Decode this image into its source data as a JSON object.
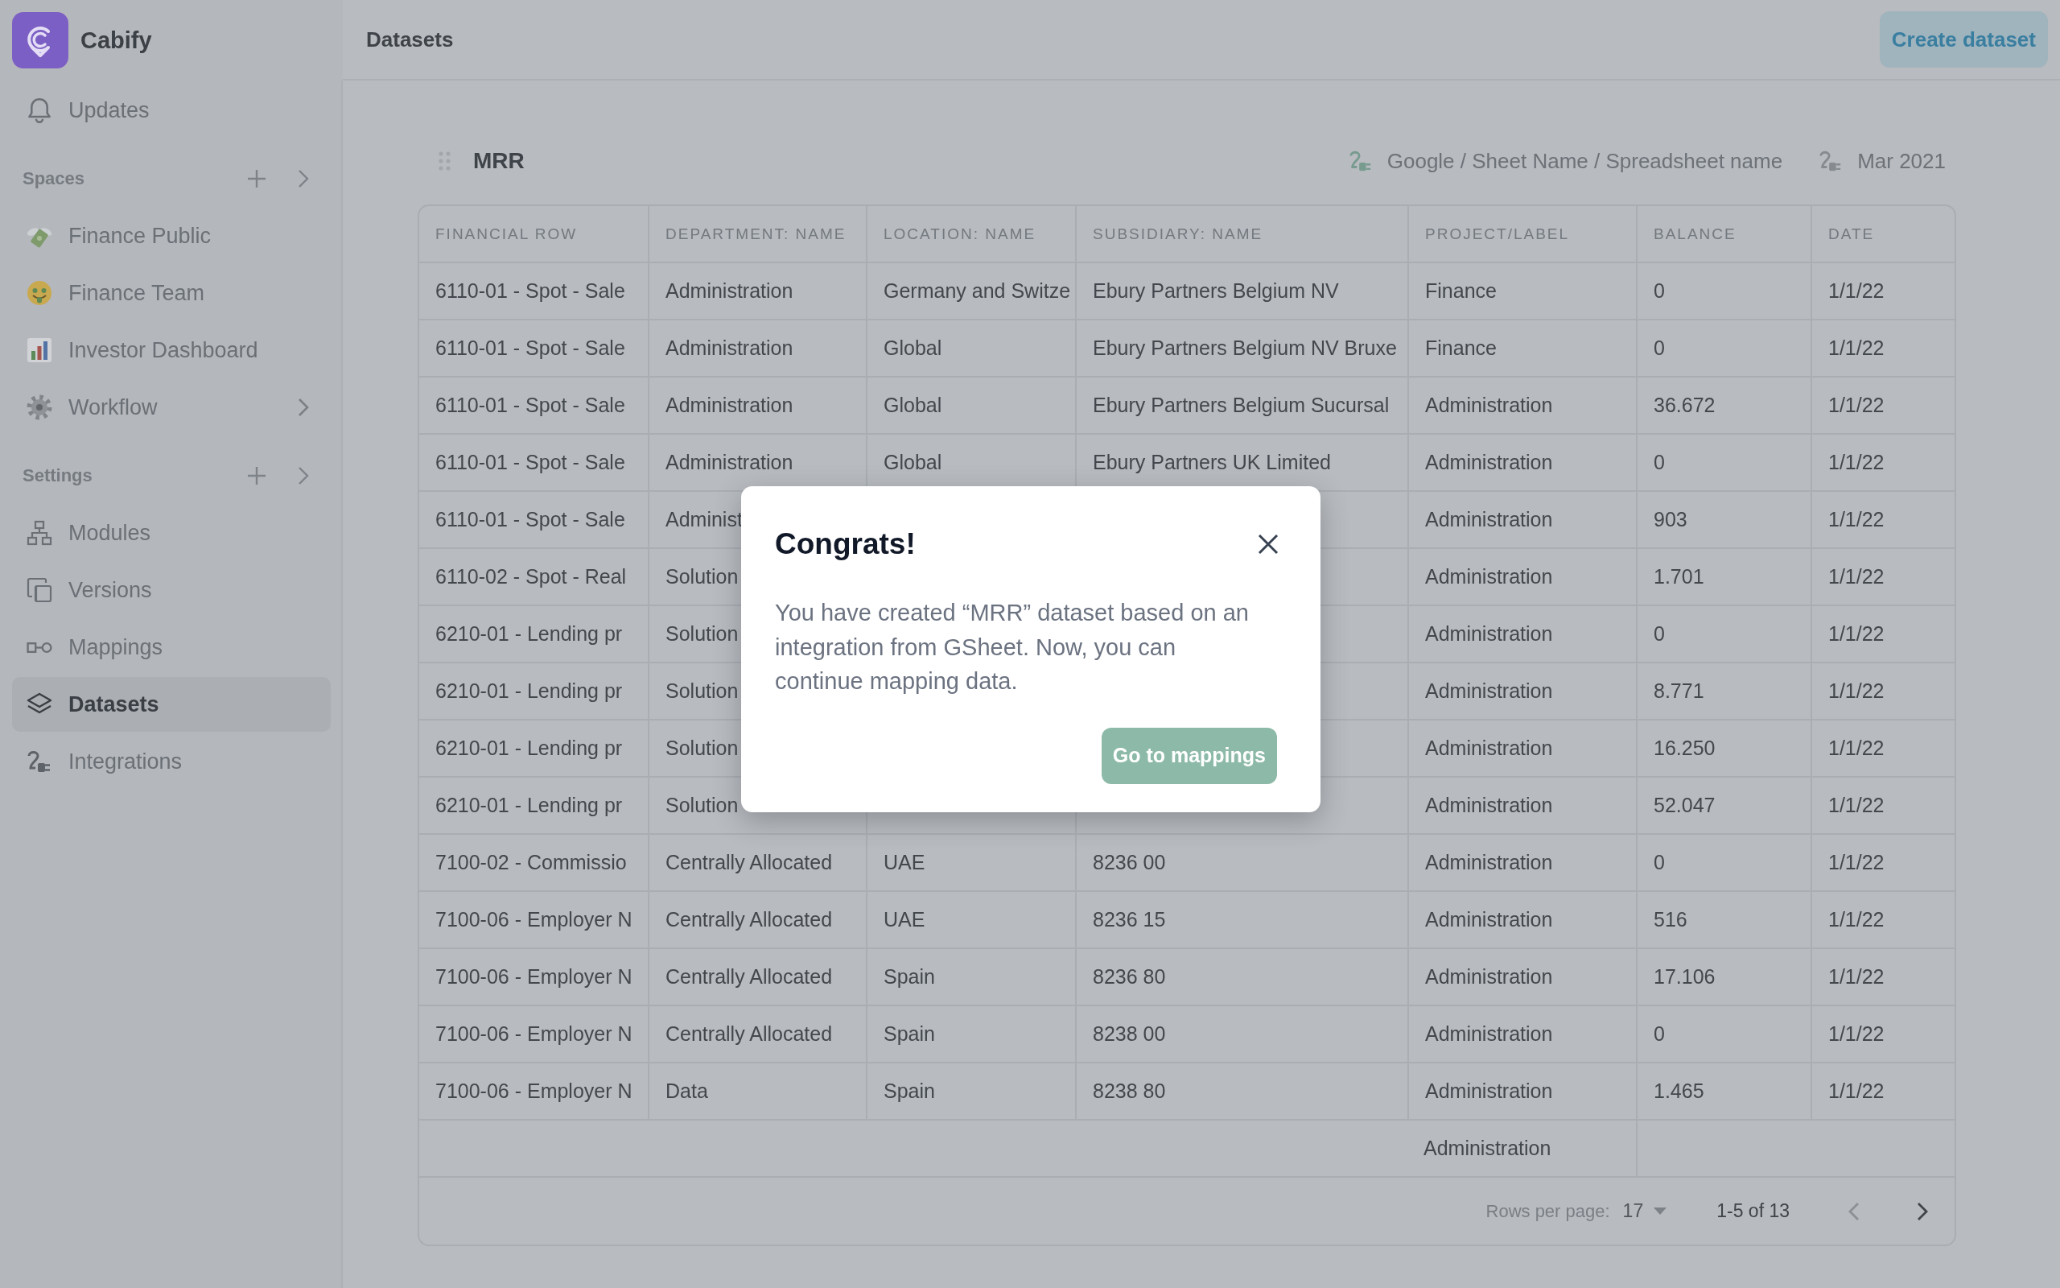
{
  "sidebar": {
    "brand": "Cabify",
    "items": [
      {
        "label": "Updates",
        "selected": false,
        "expandable": false
      }
    ],
    "sections": [
      {
        "title": "Spaces",
        "items": [
          {
            "label": "Finance Public",
            "selected": false,
            "expandable": false
          },
          {
            "label": "Finance Team",
            "selected": false,
            "expandable": false
          },
          {
            "label": "Investor Dashboard",
            "selected": false,
            "expandable": false
          },
          {
            "label": "Workflow",
            "selected": false,
            "expandable": true
          }
        ]
      },
      {
        "title": "Settings",
        "items": [
          {
            "label": "Modules",
            "selected": false,
            "expandable": false
          },
          {
            "label": "Versions",
            "selected": false,
            "expandable": false
          },
          {
            "label": "Mappings",
            "selected": false,
            "expandable": false
          },
          {
            "label": "Datasets",
            "selected": true,
            "expandable": false
          },
          {
            "label": "Integrations",
            "selected": false,
            "expandable": false
          }
        ]
      }
    ]
  },
  "topbar": {
    "title": "Datasets",
    "action": "Create dataset"
  },
  "dataset": {
    "title": "MRR",
    "source": "Google / Sheet Name / Spreadsheet name",
    "period": "Mar 2021"
  },
  "table": {
    "columns": [
      "FINANCIAL ROW",
      "DEPARTMENT: NAME",
      "LOCATION: NAME",
      "SUBSIDIARY: NAME",
      "PROJECT/LABEL",
      "BALANCE",
      "DATE"
    ],
    "rows": [
      {
        "kind": "data",
        "cells": [
          "6110-01 - Spot - Sale",
          "Administration",
          "Germany and Switze",
          "Ebury Partners Belgium NV",
          "Finance",
          "0",
          "1/1/22"
        ]
      },
      {
        "kind": "data",
        "cells": [
          "6110-01 - Spot - Sale",
          "Administration",
          "Global",
          "Ebury Partners Belgium NV Bruxe",
          "Finance",
          "0",
          "1/1/22"
        ]
      },
      {
        "kind": "data",
        "cells": [
          "6110-01 - Spot - Sale",
          "Administration",
          "Global",
          "Ebury Partners Belgium Sucursal",
          "Administration",
          "36.672",
          "1/1/22"
        ]
      },
      {
        "kind": "data",
        "cells": [
          "6110-01 - Spot - Sale",
          "Administration",
          "Global",
          "Ebury Partners UK Limited",
          "Administration",
          "0",
          "1/1/22"
        ]
      },
      {
        "kind": "data",
        "cells": [
          "6110-01 - Spot - Sale",
          "Administ",
          null,
          null,
          "Administration",
          "903",
          "1/1/22"
        ]
      },
      {
        "kind": "data",
        "cells": [
          "6110-02 - Spot - Real",
          "Solution",
          null,
          null,
          "Administration",
          "1.701",
          "1/1/22"
        ]
      },
      {
        "kind": "data",
        "cells": [
          "6210-01 - Lending pr",
          "Solution",
          null,
          null,
          "Administration",
          "0",
          "1/1/22"
        ]
      },
      {
        "kind": "data",
        "cells": [
          "6210-01 - Lending pr",
          "Solution",
          null,
          null,
          "Administration",
          "8.771",
          "1/1/22"
        ]
      },
      {
        "kind": "data",
        "cells": [
          "6210-01 - Lending pr",
          "Solution",
          null,
          null,
          "Administration",
          "16.250",
          "1/1/22"
        ]
      },
      {
        "kind": "data",
        "cells": [
          "6210-01 - Lending pr",
          "Solution",
          null,
          null,
          "Administration",
          "52.047",
          "1/1/22"
        ]
      },
      {
        "kind": "data",
        "cells": [
          "7100-02 - Commissio",
          "Centrally Allocated",
          "UAE",
          "8236 00",
          "Administration",
          "0",
          "1/1/22"
        ]
      },
      {
        "kind": "data",
        "cells": [
          "7100-06 - Employer N",
          "Centrally Allocated",
          "UAE",
          "8236 15",
          "Administration",
          "516",
          "1/1/22"
        ]
      },
      {
        "kind": "data",
        "cells": [
          "7100-06 - Employer N",
          "Centrally Allocated",
          "Spain",
          "8236 80",
          "Administration",
          "17.106",
          "1/1/22"
        ]
      },
      {
        "kind": "data",
        "cells": [
          "7100-06 - Employer N",
          "Centrally Allocated",
          "Spain",
          "8238 00",
          "Administration",
          "0",
          "1/1/22"
        ]
      },
      {
        "kind": "data",
        "cells": [
          "7100-06 - Employer N",
          "Data",
          "Spain",
          "8238 80",
          "Administration",
          "1.465",
          "1/1/22"
        ]
      },
      {
        "kind": "summary",
        "cells": [
          null,
          null,
          null,
          null,
          "Administration",
          null,
          null
        ]
      }
    ],
    "pagination": {
      "rows_per_page_label": "Rows per page:",
      "rows_per_page": "17",
      "range": "1-5 of 13",
      "previous": {
        "disabled": true
      },
      "next": {
        "disabled": false
      }
    }
  },
  "dialog": {
    "title": "Congrats!",
    "message": "You have created “MRR” dataset based on an integration from GSheet. Now, you can continue mapping data.",
    "button": "Go to mappings"
  }
}
